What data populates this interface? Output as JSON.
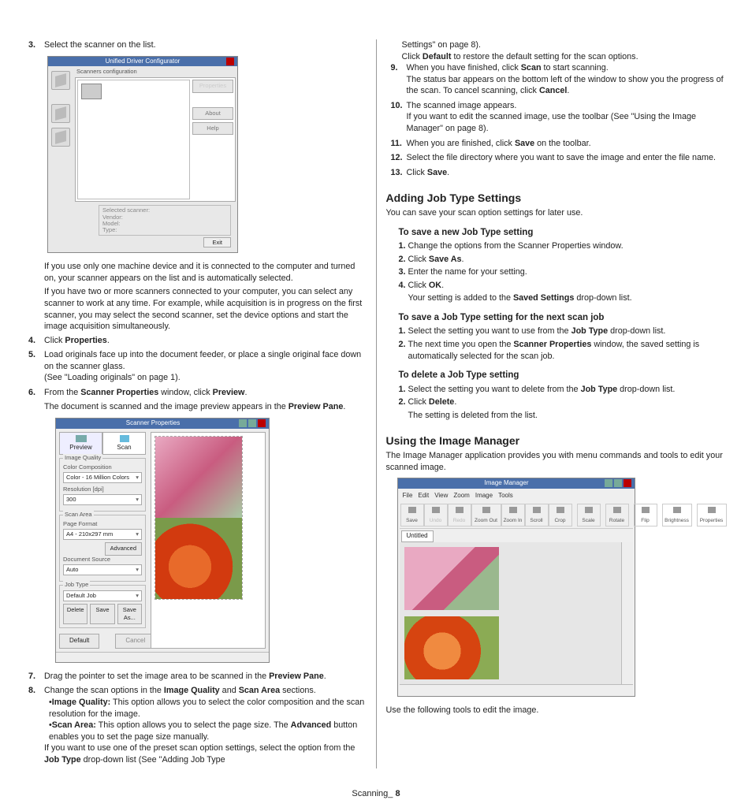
{
  "left": {
    "s3": {
      "num": "3.",
      "text": "Select the scanner on the list."
    },
    "udc": {
      "title": "Unified Driver Configurator",
      "groupLabel": "Scanners configuration",
      "buttons": {
        "props": "Properties",
        "about": "About",
        "help": "Help",
        "exit": "Exit"
      },
      "selected": {
        "legend": "Selected scanner:",
        "vendor": "Vendor:",
        "model": "Model:",
        "type": "Type:"
      }
    },
    "p1": "If you use only one machine device and it is connected to the computer and turned on, your scanner appears on the list and is automatically selected.",
    "p2": "If you have two or more scanners connected to your computer, you can select any scanner to work at any time. For example, while acquisition is in progress on the first scanner, you may select the second scanner, set the device options and start the image acquisition simultaneously.",
    "s4": {
      "num": "4.",
      "pre": "Click ",
      "bold": "Properties",
      "post": "."
    },
    "s5": {
      "num": "5.",
      "text": "Load originals face up into the document feeder, or place a single original face down on the scanner glass.",
      "ref": "(See \"Loading originals\" on page 1)."
    },
    "s6": {
      "num": "6.",
      "pre": "From the ",
      "b1": "Scanner Properties",
      "mid": " window, click ",
      "b2": "Preview",
      "post": "."
    },
    "p3a": "The document is scanned and the image preview appears in the ",
    "p3b": "Preview Pane",
    "sp": {
      "title": "Scanner Properties",
      "tabs": {
        "preview": "Preview",
        "scan": "Scan"
      },
      "g1": {
        "title": "Image Quality",
        "f1lbl": "Color Composition",
        "f1": "Color - 16 Million Colors",
        "f2lbl": "Resolution [dpi]",
        "f2": "300"
      },
      "g2": {
        "title": "Scan Area",
        "f1lbl": "Page Format",
        "f1": "A4 - 210x297 mm",
        "adv": "Advanced",
        "f2lbl": "Document Source",
        "f2": "Auto"
      },
      "g3": {
        "title": "Job Type",
        "f1": "Default Job",
        "del": "Delete",
        "save": "Save",
        "saveas": "Save As..."
      },
      "bot": {
        "default": "Default",
        "cancel": "Cancel"
      }
    },
    "s7": {
      "num": "7.",
      "pre": "Drag the pointer to set the image area to be scanned in the ",
      "b": "Preview Pane",
      "post": "."
    },
    "s8": {
      "num": "8.",
      "pre": "Change the scan options in the ",
      "b1": "Image Quality",
      "mid": " and ",
      "b2": "Scan Area",
      "post": " sections."
    },
    "s8a": {
      "bt": "Image Quality:",
      "txt": "  This option allows you to select the color composition and the scan resolution for the image."
    },
    "s8b": {
      "bt": "Scan Area:",
      "txt": "  This option allows you to select the page size. The ",
      "b2": "Advanced",
      "txt2": " button enables you to set the page size manually."
    },
    "p4a": "If you want to use one of the preset scan option settings, select the option from the ",
    "p4b": "Job Type",
    "p4c": " drop-down list (See \"Adding Job Type "
  },
  "right": {
    "cont": "Settings\" on page 8).",
    "defa": "Click ",
    "defb": "Default",
    "defc": " to restore the default setting for the scan options.",
    "s9": {
      "num": "9.",
      "pre": "When you have finished, click ",
      "b": "Scan",
      "post": " to start scanning."
    },
    "s9b": {
      "pre": "The status bar appears on the bottom left of the window to show you the progress of the scan. To cancel scanning, click ",
      "b": "Cancel",
      "post": "."
    },
    "s10": {
      "num": "10.",
      "text": "The scanned image appears."
    },
    "s10b": "If you want to edit the scanned image, use the toolbar (See \"Using the Image Manager\" on page 8).",
    "s11": {
      "num": "11.",
      "pre": "When you are finished, click ",
      "b": "Save",
      "post": " on the toolbar."
    },
    "s12": {
      "num": "12.",
      "text": "Select the file directory where you want to save the image and enter the file name."
    },
    "s13": {
      "num": "13.",
      "pre": "Click ",
      "b": "Save",
      "post": "."
    },
    "h_add": "Adding Job Type Settings",
    "add_sub": "You can save your scan option settings for later use.",
    "h_savenew": "To save a new Job Type setting",
    "sn": {
      "1": {
        "n": "1.",
        "t": "Change the options from the Scanner Properties window."
      },
      "2": {
        "n": "2.",
        "p": "Click ",
        "b": "Save As",
        "e": "."
      },
      "3": {
        "n": "3.",
        "t": "Enter the name for your setting."
      },
      "4": {
        "n": "4.",
        "p": "Click ",
        "b": "OK",
        "e": "."
      },
      "4b": {
        "p": "Your setting is added to the ",
        "b": "Saved Settings",
        "e": " drop-down list."
      }
    },
    "h_savenext": "To save a Job Type setting for the next scan job",
    "sx": {
      "1": {
        "n": "1.",
        "p": "Select the setting you want to use from the ",
        "b": "Job Type",
        "e": " drop-down list."
      },
      "2": {
        "n": "2.",
        "p": "The next time you open the ",
        "b": "Scanner Properties",
        "e": " window, the saved setting is automatically selected for the scan job."
      }
    },
    "h_del": "To delete a Job Type setting",
    "sd": {
      "1": {
        "n": "1.",
        "p": "Select the setting you want to delete from the ",
        "b": "Job Type",
        "e": " drop-down list."
      },
      "2": {
        "n": "2.",
        "p": "Click ",
        "b": "Delete",
        "e": "."
      },
      "2b": "The setting is deleted from the list."
    },
    "h_im": "Using the Image Manager",
    "im_sub": "The Image Manager application provides you with menu commands and tools to edit your scanned image.",
    "im": {
      "title": "Image Manager",
      "menu": {
        "file": "File",
        "edit": "Edit",
        "view": "View",
        "zoom": "Zoom",
        "image": "Image",
        "tools": "Tools"
      },
      "tools": {
        "save": "Save",
        "undo": "Undo",
        "redo": "Redo",
        "zout": "Zoom Out",
        "zin": "Zoom In",
        "scroll": "Scroll",
        "crop": "Crop",
        "scale": "Scale",
        "rotate": "Rotate",
        "flip": "Flip",
        "bright": "Brightness",
        "props": "Properties"
      },
      "tab": "Untitled"
    },
    "im_after": "Use the following tools to edit the image."
  },
  "footer": {
    "label": "Scanning_",
    "page": "8"
  }
}
